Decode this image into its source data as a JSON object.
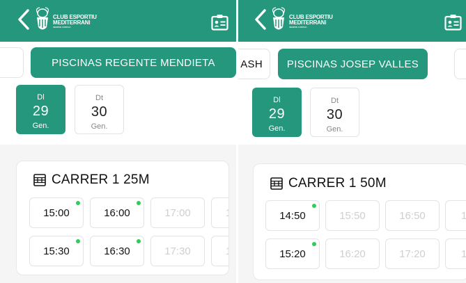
{
  "colors": {
    "accent": "#24977c",
    "available_dot": "#2ecc5a"
  },
  "brand": {
    "name_line1": "CLUB ESPORTIU",
    "name_line2": "MEDITERRANI",
    "tagline": "SIEMPRE CONTIGO"
  },
  "left": {
    "pools": [
      {
        "label": "PISCINAS REGENTE MENDIETA",
        "active": true
      }
    ],
    "days": [
      {
        "dow": "Dl",
        "num": "29",
        "month": "Gen.",
        "active": true
      },
      {
        "dow": "Dt",
        "num": "30",
        "month": "Gen.",
        "active": false
      }
    ],
    "lane": {
      "title": "CARRER 1 25M",
      "rows": [
        [
          {
            "time": "15:00",
            "available": true
          },
          {
            "time": "16:00",
            "available": true
          },
          {
            "time": "17:00",
            "available": false
          },
          {
            "time": "1",
            "available": false
          }
        ],
        [
          {
            "time": "15:30",
            "available": true
          },
          {
            "time": "16:30",
            "available": true
          },
          {
            "time": "17:30",
            "available": false
          },
          {
            "time": "1",
            "available": false
          }
        ]
      ]
    }
  },
  "right": {
    "pools": [
      {
        "label": "ASH",
        "active": false
      },
      {
        "label": "PISCINAS JOSEP VALLES",
        "active": true
      }
    ],
    "days": [
      {
        "dow": "Dl",
        "num": "29",
        "month": "Gen.",
        "active": true
      },
      {
        "dow": "Dt",
        "num": "30",
        "month": "Gen.",
        "active": false
      }
    ],
    "lane": {
      "title": "CARRER 1 50M",
      "rows": [
        [
          {
            "time": "14:50",
            "available": true
          },
          {
            "time": "15:50",
            "available": false
          },
          {
            "time": "16:50",
            "available": false
          },
          {
            "time": "1",
            "available": false
          }
        ],
        [
          {
            "time": "15:20",
            "available": true
          },
          {
            "time": "16:20",
            "available": false
          },
          {
            "time": "17:20",
            "available": false
          },
          {
            "time": "1",
            "available": false
          }
        ]
      ]
    }
  }
}
